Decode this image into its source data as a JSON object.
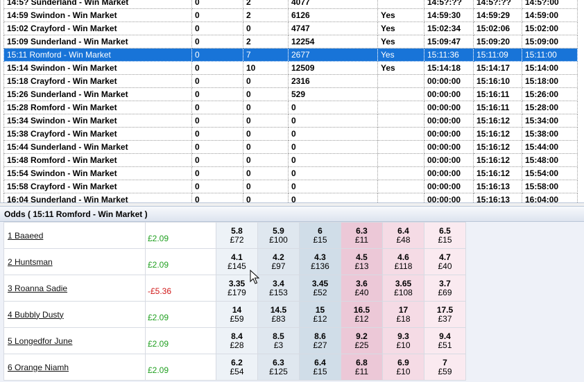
{
  "markets": {
    "rows": [
      {
        "name": "14:5? Sunderland - Win Market",
        "c1": "0",
        "c2": "2",
        "matched": "4077",
        "inplay": "",
        "t1": "14:5?:??",
        "t2": "14:5?:??",
        "t3": "14:5?:00",
        "selected": false
      },
      {
        "name": "14:59 Swindon - Win Market",
        "c1": "0",
        "c2": "2",
        "matched": "6126",
        "inplay": "Yes",
        "t1": "14:59:30",
        "t2": "14:59:29",
        "t3": "14:59:00",
        "selected": false
      },
      {
        "name": "15:02 Crayford - Win Market",
        "c1": "0",
        "c2": "0",
        "matched": "4747",
        "inplay": "Yes",
        "t1": "15:02:34",
        "t2": "15:02:06",
        "t3": "15:02:00",
        "selected": false
      },
      {
        "name": "15:09 Sunderland - Win Market",
        "c1": "0",
        "c2": "2",
        "matched": "12254",
        "inplay": "Yes",
        "t1": "15:09:47",
        "t2": "15:09:20",
        "t3": "15:09:00",
        "selected": false
      },
      {
        "name": "15:11 Romford - Win Market",
        "c1": "0",
        "c2": "7",
        "matched": "2677",
        "inplay": "Yes",
        "t1": "15:11:36",
        "t2": "15:11:09",
        "t3": "15:11:00",
        "selected": true
      },
      {
        "name": "15:14 Swindon - Win Market",
        "c1": "0",
        "c2": "10",
        "matched": "12509",
        "inplay": "Yes",
        "t1": "15:14:18",
        "t2": "15:14:17",
        "t3": "15:14:00",
        "selected": false
      },
      {
        "name": "15:18 Crayford - Win Market",
        "c1": "0",
        "c2": "0",
        "matched": "2316",
        "inplay": "",
        "t1": "00:00:00",
        "t2": "15:16:10",
        "t3": "15:18:00",
        "selected": false
      },
      {
        "name": "15:26 Sunderland - Win Market",
        "c1": "0",
        "c2": "0",
        "matched": "529",
        "inplay": "",
        "t1": "00:00:00",
        "t2": "15:16:11",
        "t3": "15:26:00",
        "selected": false
      },
      {
        "name": "15:28 Romford - Win Market",
        "c1": "0",
        "c2": "0",
        "matched": "0",
        "inplay": "",
        "t1": "00:00:00",
        "t2": "15:16:11",
        "t3": "15:28:00",
        "selected": false
      },
      {
        "name": "15:34 Swindon - Win Market",
        "c1": "0",
        "c2": "0",
        "matched": "0",
        "inplay": "",
        "t1": "00:00:00",
        "t2": "15:16:12",
        "t3": "15:34:00",
        "selected": false
      },
      {
        "name": "15:38 Crayford - Win Market",
        "c1": "0",
        "c2": "0",
        "matched": "0",
        "inplay": "",
        "t1": "00:00:00",
        "t2": "15:16:12",
        "t3": "15:38:00",
        "selected": false
      },
      {
        "name": "15:44 Sunderland - Win Market",
        "c1": "0",
        "c2": "0",
        "matched": "0",
        "inplay": "",
        "t1": "00:00:00",
        "t2": "15:16:12",
        "t3": "15:44:00",
        "selected": false
      },
      {
        "name": "15:48 Romford - Win Market",
        "c1": "0",
        "c2": "0",
        "matched": "0",
        "inplay": "",
        "t1": "00:00:00",
        "t2": "15:16:12",
        "t3": "15:48:00",
        "selected": false
      },
      {
        "name": "15:54 Swindon - Win Market",
        "c1": "0",
        "c2": "0",
        "matched": "0",
        "inplay": "",
        "t1": "00:00:00",
        "t2": "15:16:12",
        "t3": "15:54:00",
        "selected": false
      },
      {
        "name": "15:58 Crayford - Win Market",
        "c1": "0",
        "c2": "0",
        "matched": "0",
        "inplay": "",
        "t1": "00:00:00",
        "t2": "15:16:13",
        "t3": "15:58:00",
        "selected": false
      },
      {
        "name": "16:04 Sunderland - Win Market",
        "c1": "0",
        "c2": "0",
        "matched": "0",
        "inplay": "",
        "t1": "00:00:00",
        "t2": "15:16:13",
        "t3": "16:04:00",
        "selected": false
      }
    ]
  },
  "odds": {
    "header": "Odds ( 15:11 Romford - Win Market )",
    "runners": [
      {
        "name": "1 Baaeed",
        "pl": "£2.09",
        "pl_sign": "pos",
        "back": [
          {
            "o": "5.8",
            "s": "£72"
          },
          {
            "o": "5.9",
            "s": "£100"
          },
          {
            "o": "6",
            "s": "£15"
          }
        ],
        "lay": [
          {
            "o": "6.3",
            "s": "£11"
          },
          {
            "o": "6.4",
            "s": "£48"
          },
          {
            "o": "6.5",
            "s": "£15"
          }
        ]
      },
      {
        "name": "2 Huntsman",
        "pl": "£2.09",
        "pl_sign": "pos",
        "back": [
          {
            "o": "4.1",
            "s": "£145"
          },
          {
            "o": "4.2",
            "s": "£97"
          },
          {
            "o": "4.3",
            "s": "£136"
          }
        ],
        "lay": [
          {
            "o": "4.5",
            "s": "£13"
          },
          {
            "o": "4.6",
            "s": "£118"
          },
          {
            "o": "4.7",
            "s": "£40"
          }
        ]
      },
      {
        "name": "3 Roanna Sadie",
        "pl": "-£5.36",
        "pl_sign": "neg",
        "back": [
          {
            "o": "3.35",
            "s": "£179"
          },
          {
            "o": "3.4",
            "s": "£153"
          },
          {
            "o": "3.45",
            "s": "£52"
          }
        ],
        "lay": [
          {
            "o": "3.6",
            "s": "£40"
          },
          {
            "o": "3.65",
            "s": "£108"
          },
          {
            "o": "3.7",
            "s": "£69"
          }
        ]
      },
      {
        "name": "4 Bubbly Dusty",
        "pl": "£2.09",
        "pl_sign": "pos",
        "back": [
          {
            "o": "14",
            "s": "£59"
          },
          {
            "o": "14.5",
            "s": "£83"
          },
          {
            "o": "15",
            "s": "£12"
          }
        ],
        "lay": [
          {
            "o": "16.5",
            "s": "£12"
          },
          {
            "o": "17",
            "s": "£18"
          },
          {
            "o": "17.5",
            "s": "£37"
          }
        ]
      },
      {
        "name": "5 Longedfor June",
        "pl": "£2.09",
        "pl_sign": "pos",
        "back": [
          {
            "o": "8.4",
            "s": "£28"
          },
          {
            "o": "8.5",
            "s": "£3"
          },
          {
            "o": "8.6",
            "s": "£27"
          }
        ],
        "lay": [
          {
            "o": "9.2",
            "s": "£25"
          },
          {
            "o": "9.3",
            "s": "£10"
          },
          {
            "o": "9.4",
            "s": "£51"
          }
        ]
      },
      {
        "name": "6 Orange Niamh",
        "pl": "£2.09",
        "pl_sign": "pos",
        "back": [
          {
            "o": "6.2",
            "s": "£54"
          },
          {
            "o": "6.3",
            "s": "£125"
          },
          {
            "o": "6.4",
            "s": "£15"
          }
        ],
        "lay": [
          {
            "o": "6.8",
            "s": "£11"
          },
          {
            "o": "6.9",
            "s": "£10"
          },
          {
            "o": "7",
            "s": "£59"
          }
        ]
      }
    ]
  },
  "colors": {
    "selection": "#1874d8",
    "profit": "#1f9f1f",
    "loss": "#d01818",
    "back": "#d0dde8",
    "lay": "#ecc8d7"
  },
  "icons": {
    "cursor": "mouse-pointer-icon"
  }
}
